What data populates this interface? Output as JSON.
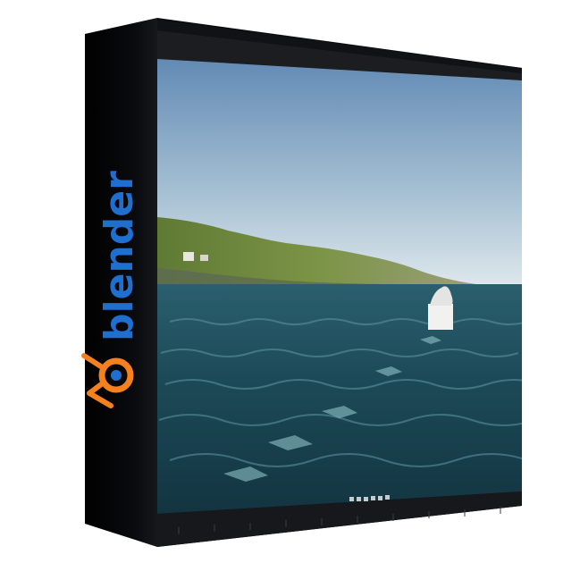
{
  "product": {
    "brand_name": "blender",
    "logo_icon": "blender-logo-icon",
    "brand_color": "#1f6fd1",
    "logo_color": "#f5801e"
  },
  "box": {
    "spine_color": "#050608",
    "frame_color": "#0c0d10"
  },
  "viewport": {
    "sky_top": "#5f88b3",
    "sky_bottom": "#dfe7ec",
    "sea_color": "#1f4d5a",
    "island_color": "#6e8a3b",
    "object": "white-cube-with-figure"
  },
  "timeline": {
    "icons": [
      "jump-start-icon",
      "step-back-icon",
      "play-reverse-icon",
      "play-icon",
      "step-forward-icon",
      "jump-end-icon"
    ]
  }
}
